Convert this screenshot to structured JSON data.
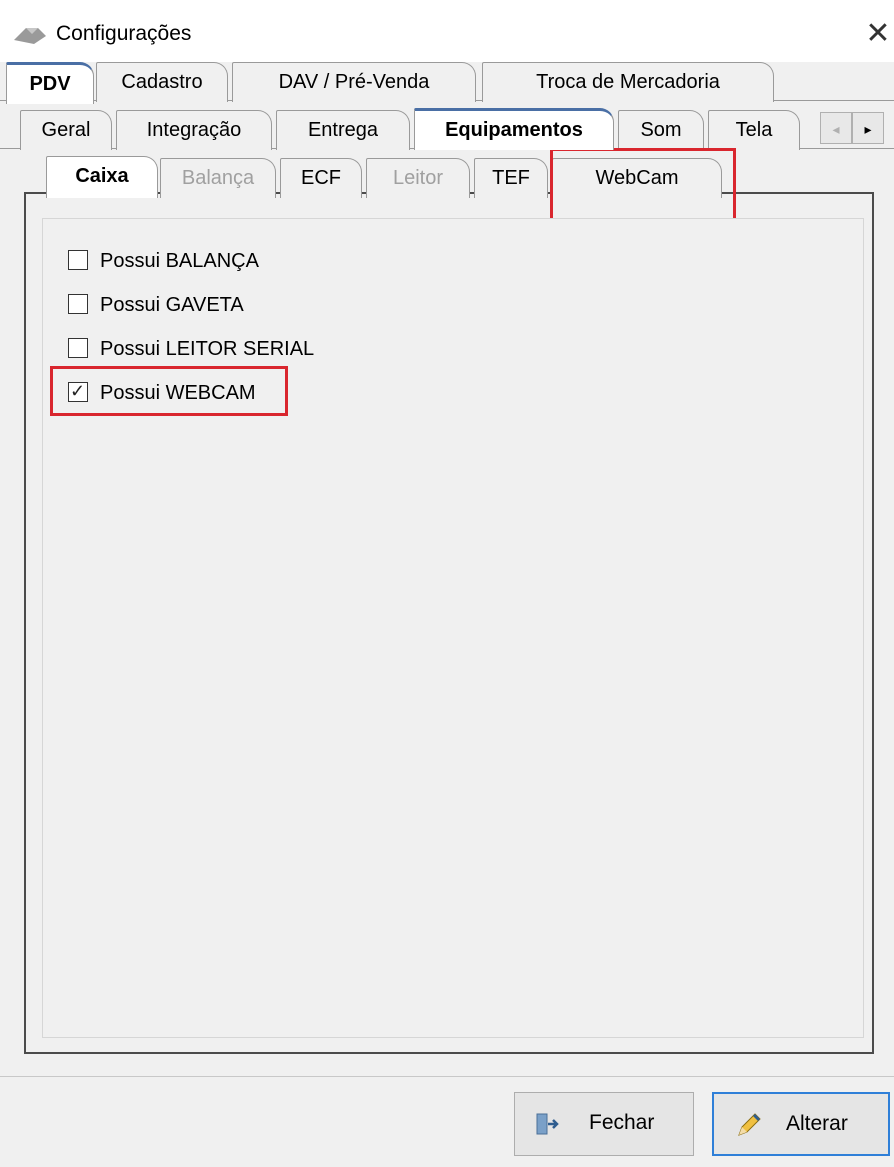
{
  "window": {
    "title": "Configurações",
    "close_label": "✕"
  },
  "tabs_row1": [
    {
      "label": "PDV",
      "active": true
    },
    {
      "label": "Cadastro",
      "active": false
    },
    {
      "label": "DAV / Pré-Venda",
      "active": false
    },
    {
      "label": "Troca de Mercadoria",
      "active": false
    }
  ],
  "tabs_row2": [
    {
      "label": "Geral",
      "active": false
    },
    {
      "label": "Integração",
      "active": false
    },
    {
      "label": "Entrega",
      "active": false
    },
    {
      "label": "Equipamentos",
      "active": true
    },
    {
      "label": "Som",
      "active": false
    },
    {
      "label": "Tela",
      "active": false
    }
  ],
  "tabs_row3": [
    {
      "label": "Caixa",
      "active": true,
      "disabled": false
    },
    {
      "label": "Balança",
      "active": false,
      "disabled": true
    },
    {
      "label": "ECF",
      "active": false,
      "disabled": false
    },
    {
      "label": "Leitor",
      "active": false,
      "disabled": true
    },
    {
      "label": "TEF",
      "active": false,
      "disabled": false
    },
    {
      "label": "WebCam",
      "active": false,
      "disabled": false
    }
  ],
  "scroll": {
    "left_icon": "◂",
    "right_icon": "▸"
  },
  "checkboxes": [
    {
      "label": "Possui BALANÇA",
      "checked": false
    },
    {
      "label": "Possui GAVETA",
      "checked": false
    },
    {
      "label": "Possui LEITOR SERIAL",
      "checked": false
    },
    {
      "label": "Possui WEBCAM",
      "checked": true
    }
  ],
  "buttons": {
    "fechar": {
      "label": "Fechar",
      "icon": "exit-door-icon"
    },
    "alterar": {
      "label": "Alterar",
      "icon": "pencil-icon"
    }
  },
  "colors": {
    "highlight": "#d9262e",
    "focus": "#2f7fd8"
  }
}
